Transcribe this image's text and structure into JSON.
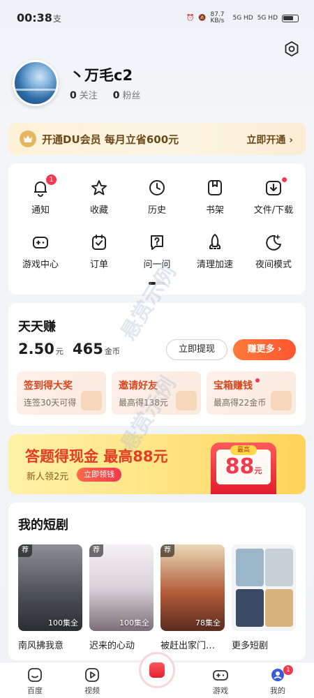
{
  "status_bar": {
    "time": "00:38",
    "extra": "支",
    "network": "87.7 KB/s",
    "sig1": "5G HD",
    "sig2": "5G HD"
  },
  "profile": {
    "username": "丶万毛c2",
    "following_count": "0",
    "following_label": "关注",
    "fans_count": "0",
    "fans_label": "粉丝"
  },
  "vip": {
    "text": "开通DU会员 每月立省600元",
    "action": "立即开通 ›",
    "accent": "#6a4818"
  },
  "grid": [
    {
      "label": "通知",
      "icon": "bell-icon",
      "badge": "1"
    },
    {
      "label": "收藏",
      "icon": "star-icon"
    },
    {
      "label": "历史",
      "icon": "clock-icon"
    },
    {
      "label": "书架",
      "icon": "bookshelf-icon"
    },
    {
      "label": "文件/下载",
      "icon": "download-icon",
      "dot": true
    },
    {
      "label": "游戏中心",
      "icon": "gamepad-icon"
    },
    {
      "label": "订单",
      "icon": "order-icon"
    },
    {
      "label": "问一问",
      "icon": "question-icon"
    },
    {
      "label": "清理加速",
      "icon": "rocket-icon"
    },
    {
      "label": "夜间模式",
      "icon": "moon-icon"
    }
  ],
  "earn": {
    "title": "天天赚",
    "cash": "2.50",
    "cash_unit": "元",
    "coins": "465",
    "coins_unit": "金币",
    "withdraw": "立即提现",
    "more": "赚更多 ›",
    "tasks": [
      {
        "title": "签到得大奖",
        "desc": "连签30天可得"
      },
      {
        "title": "邀请好友",
        "desc": "最高得138元"
      },
      {
        "title": "宝箱赚钱",
        "desc": "最高得22金币",
        "dot": true
      }
    ]
  },
  "quiz": {
    "title": "答题得现金 最高88元",
    "subtitle": "新人领2元",
    "claim": "立即领钱",
    "envelope_top": "最高",
    "envelope_amount": "88",
    "envelope_unit": "元"
  },
  "dramas": {
    "title": "我的短剧",
    "items": [
      {
        "name": "南风拂我意",
        "episodes": "100集全",
        "tag": "荐"
      },
      {
        "name": "迟来的心动",
        "episodes": "100集全",
        "tag": "荐"
      },
      {
        "name": "被赶出家门…",
        "episodes": "78集全",
        "tag": "荐"
      },
      {
        "name": "更多短剧"
      }
    ]
  },
  "nav": [
    {
      "label": "百度",
      "icon": "baidu-face-icon"
    },
    {
      "label": "视频",
      "icon": "video-play-icon"
    },
    {
      "label": "游戏",
      "icon": "gamepad-icon"
    },
    {
      "label": "我的",
      "icon": "profile-icon",
      "badge": "1"
    }
  ]
}
